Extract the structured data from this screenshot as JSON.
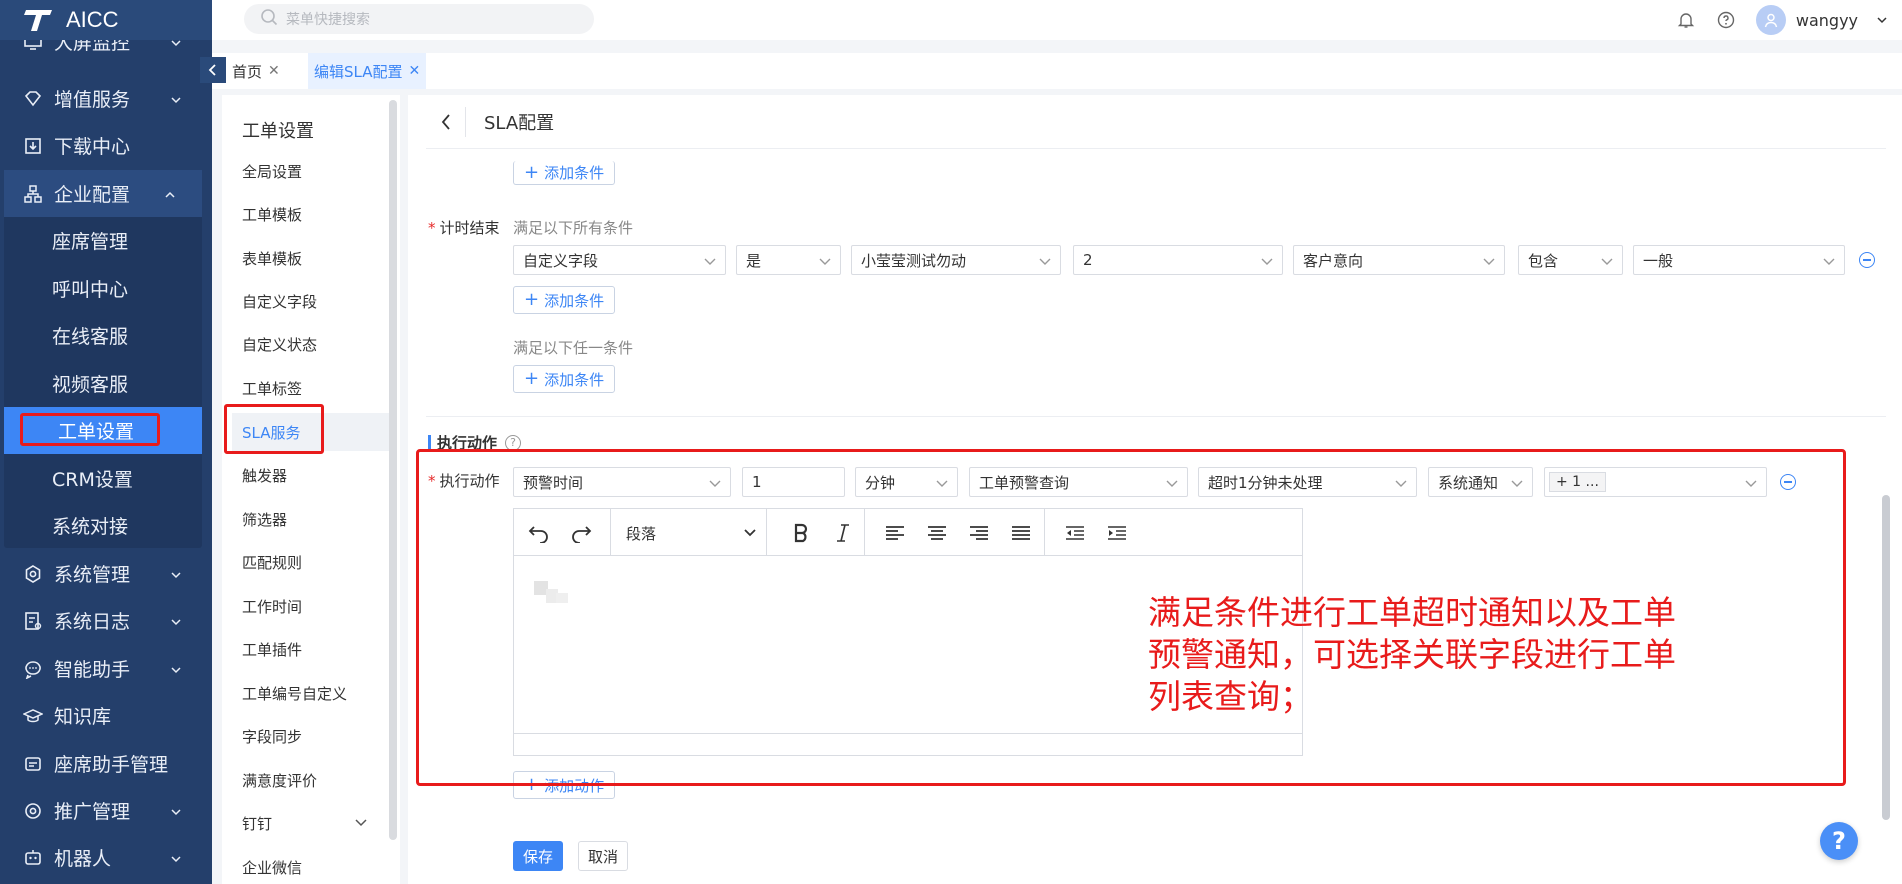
{
  "app": {
    "name": "AICC"
  },
  "search": {
    "placeholder": "菜单快捷搜索"
  },
  "user": {
    "name": "wangyy"
  },
  "tabs": [
    {
      "label": "首页"
    },
    {
      "label": "编辑SLA配置"
    }
  ],
  "sidebar": {
    "items": [
      {
        "label": "大屏监控"
      },
      {
        "label": "增值服务"
      },
      {
        "label": "下载中心"
      },
      {
        "label": "企业配置"
      },
      {
        "label": "系统管理"
      },
      {
        "label": "系统日志"
      },
      {
        "label": "智能助手"
      },
      {
        "label": "知识库"
      },
      {
        "label": "座席助手管理"
      },
      {
        "label": "推广管理"
      },
      {
        "label": "机器人"
      }
    ],
    "sub_items": [
      {
        "label": "座席管理"
      },
      {
        "label": "呼叫中心"
      },
      {
        "label": "在线客服"
      },
      {
        "label": "视频客服"
      },
      {
        "label": "工单设置"
      },
      {
        "label": "CRM设置"
      },
      {
        "label": "系统对接"
      }
    ]
  },
  "submenu": {
    "title": "工单设置",
    "items": [
      {
        "label": "全局设置"
      },
      {
        "label": "工单模板"
      },
      {
        "label": "表单模板"
      },
      {
        "label": "自定义字段"
      },
      {
        "label": "自定义状态"
      },
      {
        "label": "工单标签"
      },
      {
        "label": "SLA服务"
      },
      {
        "label": "触发器"
      },
      {
        "label": "筛选器"
      },
      {
        "label": "匹配规则"
      },
      {
        "label": "工作时间"
      },
      {
        "label": "工单插件"
      },
      {
        "label": "工单编号自定义"
      },
      {
        "label": "字段同步"
      },
      {
        "label": "满意度评价"
      },
      {
        "label": "钉钉"
      },
      {
        "label": "企业微信"
      }
    ]
  },
  "main": {
    "title": "SLA配置",
    "add_condition": "添加条件",
    "timer_end": {
      "required_mark": "*",
      "label": "计时结束",
      "all_hint": "满足以下所有条件",
      "any_hint": "满足以下任一条件",
      "row": [
        "自定义字段",
        "是",
        "小莹莹测试勿动",
        "2",
        "客户意向",
        "包含",
        "一般"
      ]
    },
    "actions_section": {
      "title": "执行动作",
      "help": "?"
    },
    "action": {
      "required_mark": "*",
      "label": "执行动作",
      "row": [
        "预警时间",
        "1",
        "分钟",
        "工单预警查询",
        "超时1分钟未处理",
        "系统通知",
        "+ 1 ..."
      ]
    },
    "editor": {
      "paragraph": "段落"
    },
    "add_action": "添加动作",
    "save": "保存",
    "cancel": "取消"
  },
  "annotation": {
    "text": "满足条件进行工单超时通知以及工单预警通知，可选择关联字段进行工单列表查询；"
  },
  "help_fab": "?"
}
